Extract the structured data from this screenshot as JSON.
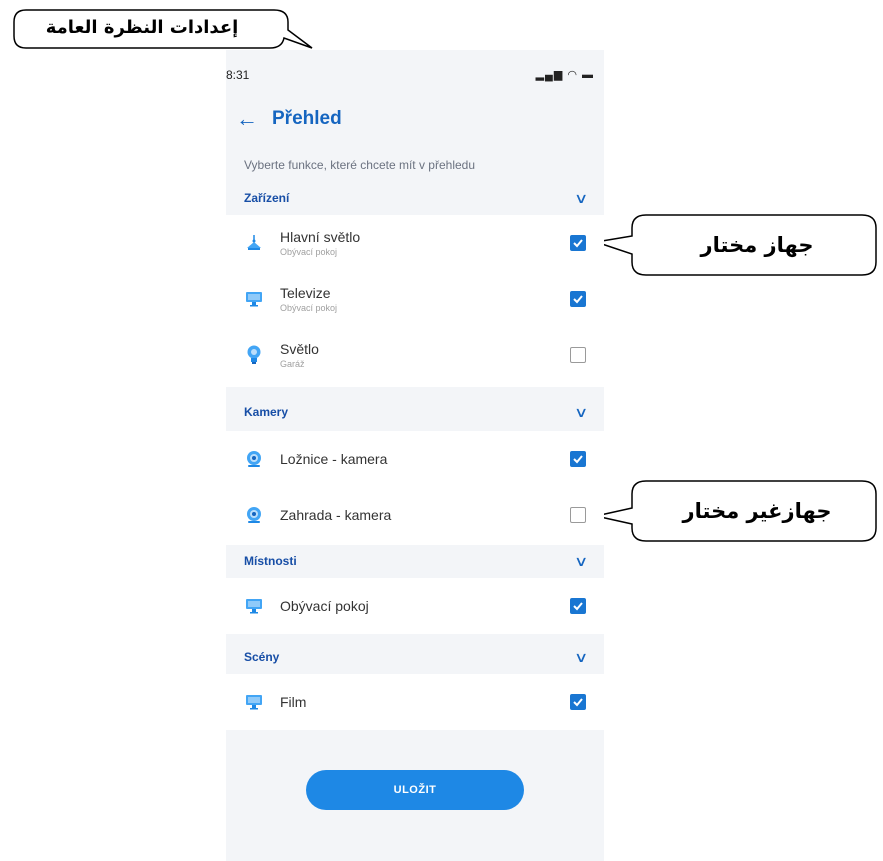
{
  "annotations": {
    "overview_settings": "إعدادات النظرة العامة",
    "selected_device": "جهاز مختار",
    "unselected_device": "جهازغير مختار"
  },
  "status_bar": {
    "time": "8:31",
    "icons": "▂▄▆ ◠ ▬"
  },
  "app_bar": {
    "back": "←",
    "title": "Přehled"
  },
  "subtitle": "Vyberte funkce, které chcete mít v přehledu",
  "sections": [
    {
      "title": "Zařízení",
      "items": [
        {
          "name": "Hlavní světlo",
          "room": "Obývací pokoj",
          "icon": "ceiling-lamp-icon",
          "checked": true
        },
        {
          "name": "Televize",
          "room": "Obývací pokoj",
          "icon": "monitor-icon",
          "checked": true
        },
        {
          "name": "Světlo",
          "room": "Garáž",
          "icon": "bulb-icon",
          "checked": false
        }
      ]
    },
    {
      "title": "Kamery",
      "items": [
        {
          "name": "Ložnice - kamera",
          "icon": "camera-icon",
          "checked": true
        },
        {
          "name": "Zahrada - kamera",
          "icon": "camera-icon",
          "checked": false
        }
      ]
    },
    {
      "title": "Místnosti",
      "items": [
        {
          "name": "Obývací pokoj",
          "icon": "monitor-icon",
          "checked": true
        }
      ]
    },
    {
      "title": "Scény",
      "items": [
        {
          "name": "Film",
          "icon": "monitor-icon",
          "checked": true
        }
      ]
    }
  ],
  "save_label": "ULOŽIT",
  "colors": {
    "accent": "#1565c0",
    "checkbox": "#1976d2",
    "button": "#1e88e5",
    "background": "#f3f5f8"
  }
}
